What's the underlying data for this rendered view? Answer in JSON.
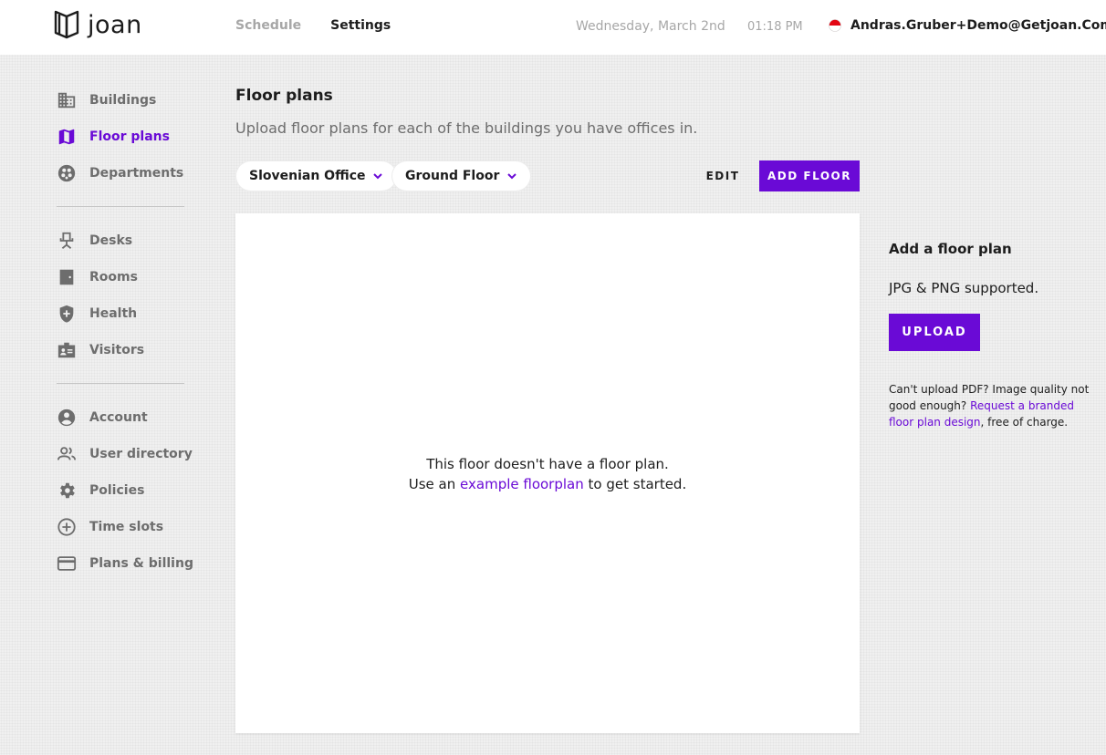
{
  "header": {
    "logo_text": "joan",
    "nav": {
      "schedule": "Schedule",
      "settings": "Settings"
    },
    "date": "Wednesday, March 2nd",
    "time": "01:18 PM",
    "user": "Andras.Gruber+Demo@Getjoan.Com"
  },
  "sidebar": {
    "group1": [
      {
        "label": "Buildings",
        "icon": "building-icon"
      },
      {
        "label": "Floor plans",
        "icon": "map-icon"
      },
      {
        "label": "Departments",
        "icon": "departments-icon"
      }
    ],
    "group2": [
      {
        "label": "Desks",
        "icon": "desk-chair-icon"
      },
      {
        "label": "Rooms",
        "icon": "door-icon"
      },
      {
        "label": "Health",
        "icon": "shield-plus-icon"
      },
      {
        "label": "Visitors",
        "icon": "badge-icon"
      }
    ],
    "group3": [
      {
        "label": "Account",
        "icon": "account-icon"
      },
      {
        "label": "User directory",
        "icon": "users-icon"
      },
      {
        "label": "Policies",
        "icon": "gear-icon"
      },
      {
        "label": "Time slots",
        "icon": "plus-circle-icon"
      },
      {
        "label": "Plans & billing",
        "icon": "credit-card-icon"
      }
    ]
  },
  "main": {
    "title": "Floor plans",
    "subtitle": "Upload floor plans for each of the buildings you have offices in.",
    "building_select": "Slovenian Office",
    "floor_select": "Ground Floor",
    "edit_label": "EDIT",
    "add_floor_label": "ADD FLOOR",
    "empty_line1": "This floor doesn't have a floor plan.",
    "empty_use": "Use an",
    "empty_link": "example floorplan",
    "empty_end": "to get started."
  },
  "right_panel": {
    "title": "Add a floor plan",
    "supported": "JPG & PNG supported.",
    "upload_label": "UPLOAD",
    "note_start": "Can't upload PDF? Image quality not good enough?",
    "note_link": "Request a branded floor plan design",
    "note_end": ", free of charge."
  },
  "colors": {
    "accent": "#6a0ad6",
    "muted": "#6d6d6d",
    "nav_inactive": "#a7a7a7",
    "flag_red": "#e30613"
  }
}
